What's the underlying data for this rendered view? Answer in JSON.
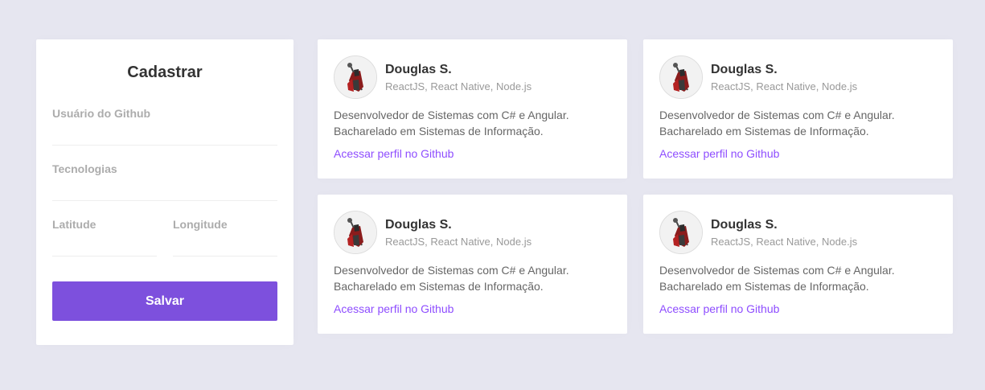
{
  "form": {
    "title": "Cadastrar",
    "github_label": "Usuário do Github",
    "github_value": "",
    "techs_label": "Tecnologias",
    "techs_value": "",
    "latitude_label": "Latitude",
    "latitude_value": "",
    "longitude_label": "Longitude",
    "longitude_value": "",
    "save_label": "Salvar"
  },
  "devs": [
    {
      "name": "Douglas S.",
      "techs": "ReactJS, React Native, Node.js",
      "bio_line1": "Desenvolvedor de Sistemas com C# e Angular.",
      "bio_line2": "Bacharelado em Sistemas de Informação.",
      "link": "Acessar perfil no Github"
    },
    {
      "name": "Douglas S.",
      "techs": "ReactJS, React Native, Node.js",
      "bio_line1": "Desenvolvedor de Sistemas com C# e Angular.",
      "bio_line2": "Bacharelado em Sistemas de Informação.",
      "link": "Acessar perfil no Github"
    },
    {
      "name": "Douglas S.",
      "techs": "ReactJS, React Native, Node.js",
      "bio_line1": "Desenvolvedor de Sistemas com C# e Angular.",
      "bio_line2": "Bacharelado em Sistemas de Informação.",
      "link": "Acessar perfil no Github"
    },
    {
      "name": "Douglas S.",
      "techs": "ReactJS, React Native, Node.js",
      "bio_line1": "Desenvolvedor de Sistemas com C# e Angular.",
      "bio_line2": "Bacharelado em Sistemas de Informação.",
      "link": "Acessar perfil no Github"
    }
  ],
  "colors": {
    "background": "#e6e6f0",
    "accent": "#7d50dd",
    "link": "#8e4dff"
  }
}
